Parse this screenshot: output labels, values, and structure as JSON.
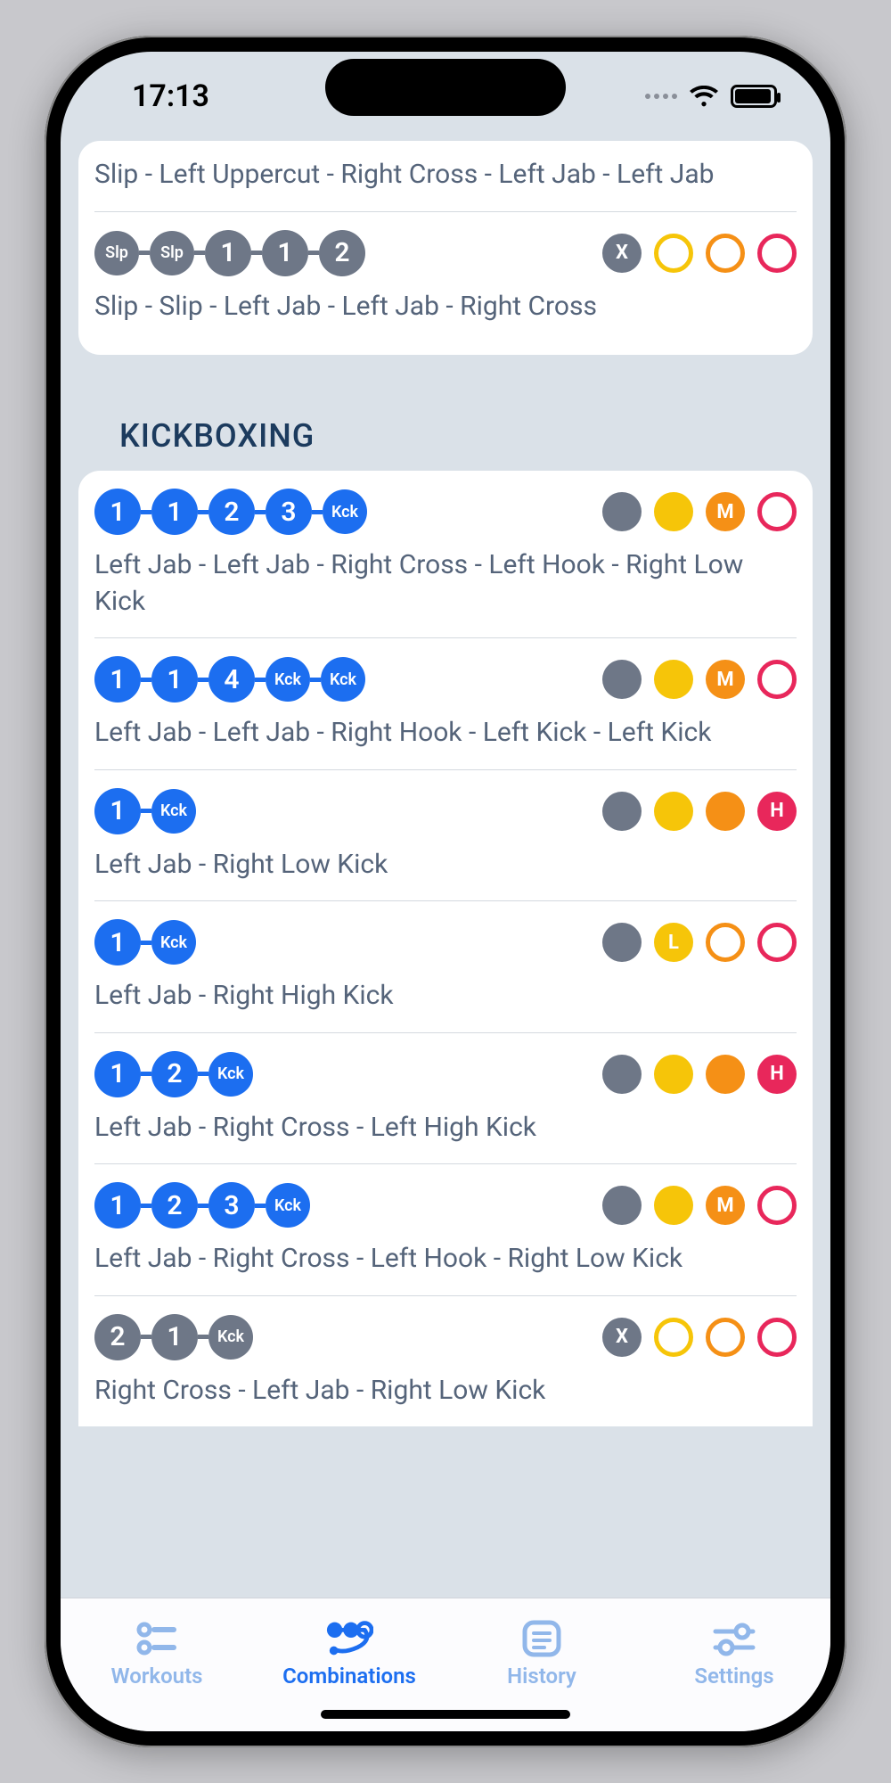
{
  "status": {
    "time": "17:13"
  },
  "sections": {
    "boxing_tail": {
      "combos": [
        {
          "chain": [],
          "chain_color": "grey",
          "desc": "Slip - Left Uppercut - Right Cross - Left Jab - Left Jab",
          "badges": []
        },
        {
          "chain": [
            "Slp",
            "Slp",
            "1",
            "1",
            "2"
          ],
          "chain_sizes": [
            "small",
            "small",
            "big",
            "big",
            "big"
          ],
          "chain_color": "grey",
          "desc": "Slip - Slip - Left Jab - Left Jab - Right Cross",
          "badges": [
            {
              "type": "b-grey-x",
              "label": "X"
            },
            {
              "type": "b-yellow-ring",
              "label": ""
            },
            {
              "type": "b-orange-ring",
              "label": ""
            },
            {
              "type": "b-pink-ring",
              "label": ""
            }
          ]
        }
      ]
    },
    "kickboxing": {
      "title": "KICKBOXING",
      "combos": [
        {
          "chain": [
            "1",
            "1",
            "2",
            "3",
            "Kck"
          ],
          "chain_sizes": [
            "big",
            "big",
            "big",
            "big",
            "small"
          ],
          "chain_color": "blue",
          "desc": "Left Jab - Left Jab - Right Cross - Left Hook - Right Low Kick",
          "badges": [
            {
              "type": "b-grey-fill",
              "label": ""
            },
            {
              "type": "b-yellow-fill",
              "label": ""
            },
            {
              "type": "b-olabel",
              "label": "M"
            },
            {
              "type": "b-pink-ring",
              "label": ""
            }
          ]
        },
        {
          "chain": [
            "1",
            "1",
            "4",
            "Kck",
            "Kck"
          ],
          "chain_sizes": [
            "big",
            "big",
            "big",
            "small",
            "small"
          ],
          "chain_color": "blue",
          "desc": "Left Jab - Left Jab - Right Hook - Left Kick - Left Kick",
          "badges": [
            {
              "type": "b-grey-fill",
              "label": ""
            },
            {
              "type": "b-yellow-fill",
              "label": ""
            },
            {
              "type": "b-olabel",
              "label": "M"
            },
            {
              "type": "b-pink-ring",
              "label": ""
            }
          ]
        },
        {
          "chain": [
            "1",
            "Kck"
          ],
          "chain_sizes": [
            "big",
            "small"
          ],
          "chain_color": "blue",
          "desc": "Left Jab - Right Low Kick",
          "badges": [
            {
              "type": "b-grey-fill",
              "label": ""
            },
            {
              "type": "b-yellow-fill",
              "label": ""
            },
            {
              "type": "b-orange-fill",
              "label": ""
            },
            {
              "type": "b-pink-fill",
              "label": "H"
            }
          ]
        },
        {
          "chain": [
            "1",
            "Kck"
          ],
          "chain_sizes": [
            "big",
            "small"
          ],
          "chain_color": "blue",
          "desc": "Left Jab - Right High Kick",
          "badges": [
            {
              "type": "b-grey-fill",
              "label": ""
            },
            {
              "type": "b-ylabel",
              "label": "L"
            },
            {
              "type": "b-orange-ring",
              "label": ""
            },
            {
              "type": "b-pink-ring",
              "label": ""
            }
          ]
        },
        {
          "chain": [
            "1",
            "2",
            "Kck"
          ],
          "chain_sizes": [
            "big",
            "big",
            "small"
          ],
          "chain_color": "blue",
          "desc": "Left Jab - Right Cross - Left High Kick",
          "badges": [
            {
              "type": "b-grey-fill",
              "label": ""
            },
            {
              "type": "b-yellow-fill",
              "label": ""
            },
            {
              "type": "b-orange-fill",
              "label": ""
            },
            {
              "type": "b-pink-fill",
              "label": "H"
            }
          ]
        },
        {
          "chain": [
            "1",
            "2",
            "3",
            "Kck"
          ],
          "chain_sizes": [
            "big",
            "big",
            "big",
            "small"
          ],
          "chain_color": "blue",
          "desc": "Left Jab - Right Cross - Left Hook - Right Low Kick",
          "badges": [
            {
              "type": "b-grey-fill",
              "label": ""
            },
            {
              "type": "b-yellow-fill",
              "label": ""
            },
            {
              "type": "b-olabel",
              "label": "M"
            },
            {
              "type": "b-pink-ring",
              "label": ""
            }
          ]
        },
        {
          "chain": [
            "2",
            "1",
            "Kck"
          ],
          "chain_sizes": [
            "big",
            "big",
            "small"
          ],
          "chain_color": "grey",
          "desc": "Right Cross - Left Jab - Right Low Kick",
          "badges": [
            {
              "type": "b-grey-x",
              "label": "X"
            },
            {
              "type": "b-yellow-ring",
              "label": ""
            },
            {
              "type": "b-orange-ring",
              "label": ""
            },
            {
              "type": "b-pink-ring",
              "label": ""
            }
          ]
        }
      ]
    }
  },
  "tabs": {
    "items": [
      {
        "id": "workouts",
        "label": "Workouts",
        "active": false
      },
      {
        "id": "combinations",
        "label": "Combinations",
        "active": true
      },
      {
        "id": "history",
        "label": "History",
        "active": false
      },
      {
        "id": "settings",
        "label": "Settings",
        "active": false
      }
    ]
  }
}
